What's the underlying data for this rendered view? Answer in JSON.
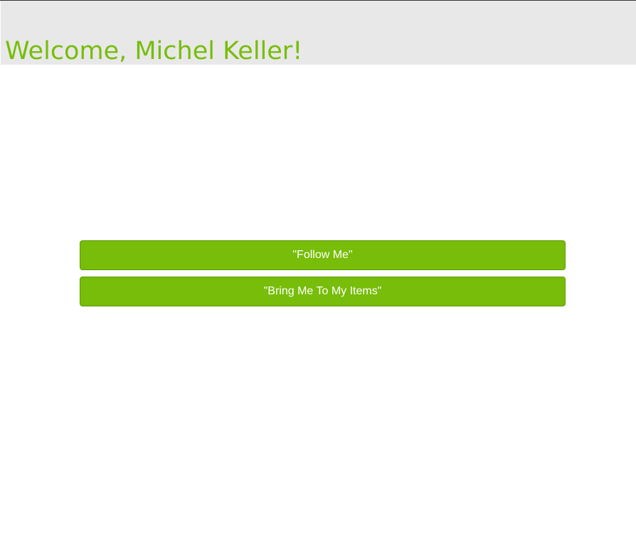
{
  "header": {
    "welcome_text": "Welcome, Michel Keller!"
  },
  "actions": {
    "follow_me_label": "\"Follow Me\"",
    "bring_me_label": "\"Bring Me To My Items\""
  },
  "colors": {
    "accent": "#77bd09",
    "header_bg": "#e8e8e8",
    "button_text": "#ffffff"
  }
}
